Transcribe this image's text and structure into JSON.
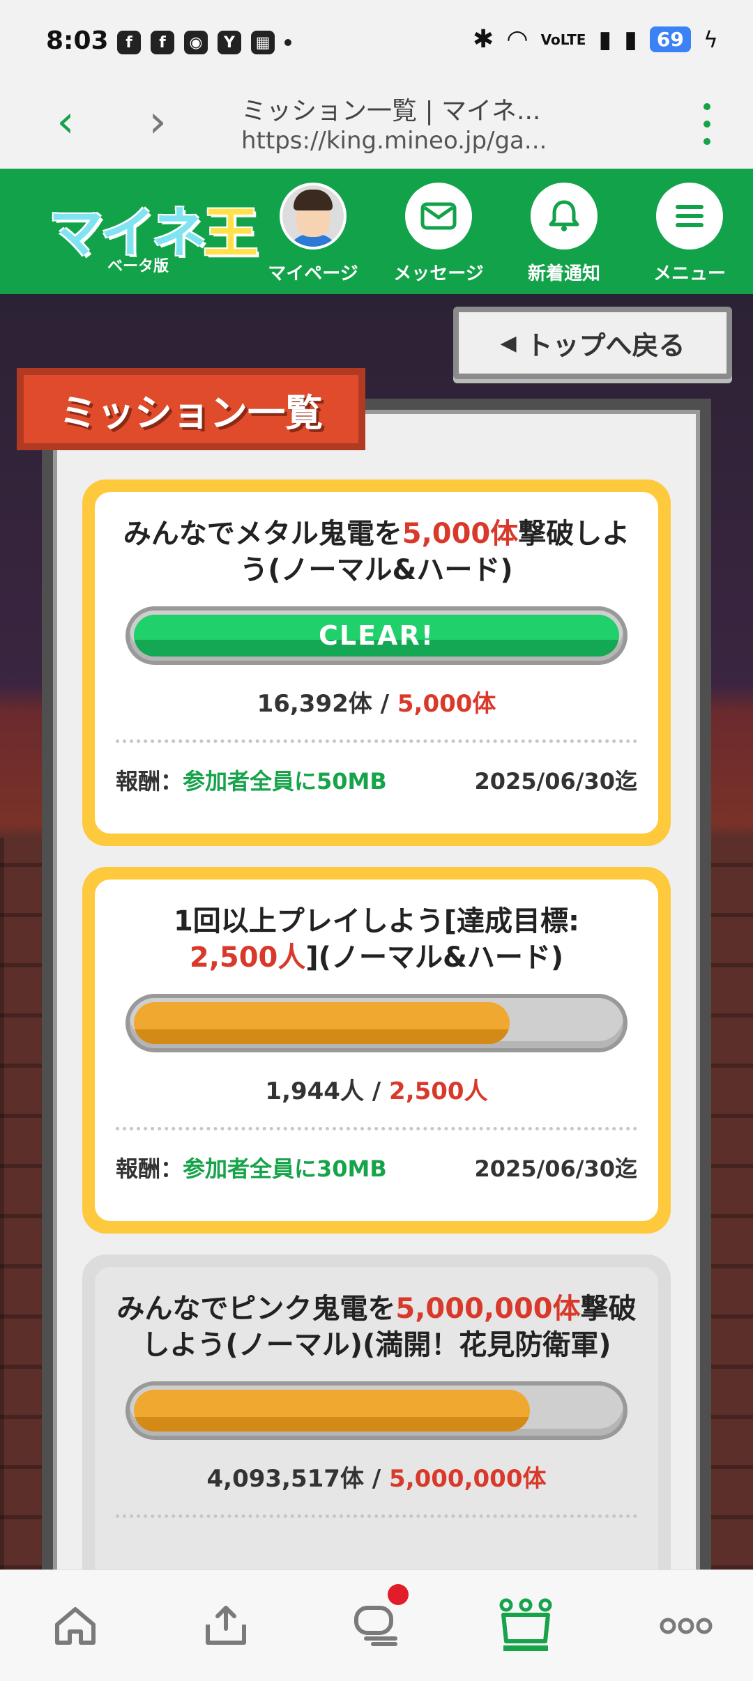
{
  "status_bar": {
    "time": "8:03",
    "left_icons": [
      "facebook-icon",
      "facebook-icon",
      "app-icon",
      "yahoo-icon",
      "gallery-icon",
      "dot-icon"
    ],
    "right_icons": [
      "bluetooth-icon",
      "wifi-icon",
      "volte-icon",
      "signal-icon",
      "signal-icon"
    ],
    "battery": "69"
  },
  "browser": {
    "tab_title": "ミッション一覧 | マイネ...",
    "url": "https://king.mineo.jp/ga..."
  },
  "header": {
    "logo_text": "マイネ王",
    "logo_sub": "ベータ版",
    "nav": [
      {
        "label": "マイページ",
        "icon": "avatar-icon"
      },
      {
        "label": "メッセージ",
        "icon": "mail-icon"
      },
      {
        "label": "新着通知",
        "icon": "bell-icon"
      },
      {
        "label": "メニュー",
        "icon": "menu-icon"
      }
    ]
  },
  "page": {
    "return_button": "トップへ戻る",
    "panel_title": "ミッション一覧"
  },
  "missions": [
    {
      "title_a": "みんなでメタル鬼電を",
      "title_red": "5,000体",
      "title_b": "撃破しよう(ノーマル&ハード)",
      "progress": 1.0,
      "bar_label": "CLEAR!",
      "current": "16,392体",
      "sep": " / ",
      "target": "5,000体",
      "reward_label": "報酬：",
      "reward": "参加者全員に50MB",
      "deadline": "2025/06/30迄",
      "status": "active"
    },
    {
      "title_a": "1回以上プレイしよう[達成目標:",
      "title_red": "2,500人",
      "title_b": "](ノーマル&ハード)",
      "progress": 0.778,
      "bar_label": "",
      "current": "1,944人",
      "sep": " / ",
      "target": "2,500人",
      "reward_label": "報酬：",
      "reward": "参加者全員に30MB",
      "deadline": "2025/06/30迄",
      "status": "active"
    },
    {
      "title_a": "みんなでピンク鬼電を",
      "title_red": "5,000,000体",
      "title_b": "撃破しよう(ノーマル)(満開！花見防衛軍)",
      "progress": 0.819,
      "bar_label": "",
      "current": "4,093,517体",
      "sep": " / ",
      "target": "5,000,000体",
      "status": "inactive"
    }
  ],
  "bottom_nav": [
    {
      "name": "home",
      "glyph": "⌂"
    },
    {
      "name": "upload",
      "glyph": "⇪"
    },
    {
      "name": "chat",
      "glyph": "💬"
    },
    {
      "name": "crown",
      "glyph": "♛"
    },
    {
      "name": "more",
      "glyph": "•••"
    }
  ]
}
